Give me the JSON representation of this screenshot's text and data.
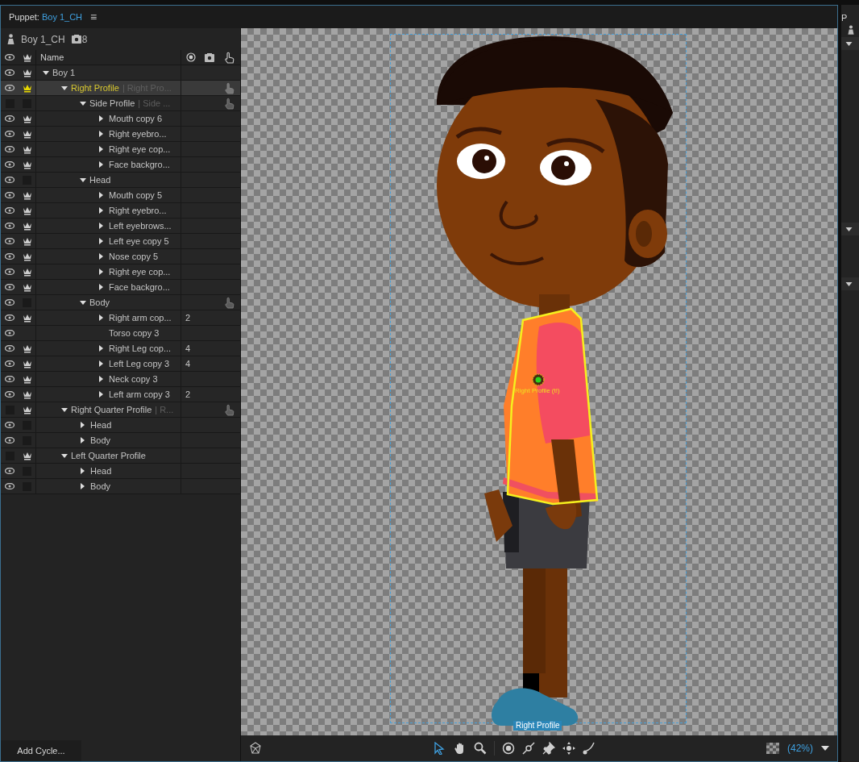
{
  "panel": {
    "title_label": "Puppet:",
    "title_name": "Boy 1_CH",
    "menu_glyph": "≡"
  },
  "puppet": {
    "name": "Boy 1_CH",
    "handle_count": "8"
  },
  "columns": {
    "name": "Name"
  },
  "layers": [
    {
      "name": "Boy 1",
      "visible": true,
      "crown": true,
      "expanded": true,
      "selected": false,
      "children": [
        {
          "name": "Right Profile",
          "note": "| Right Pro...",
          "visible": true,
          "crown": true,
          "expanded": true,
          "handle": true,
          "selected": true,
          "children": [
            {
              "name": "Side Profile",
              "note": "| Side ...",
              "visible": false,
              "crown": false,
              "expanded": true,
              "handle": true,
              "selected": false,
              "children": [
                {
                  "name": "Mouth copy 6",
                  "visible": true,
                  "crown": true,
                  "expanded": false,
                  "selected": false
                },
                {
                  "name": "Right eyebro...",
                  "visible": true,
                  "crown": true,
                  "expanded": false,
                  "selected": false
                },
                {
                  "name": "Right eye cop...",
                  "visible": true,
                  "crown": true,
                  "expanded": false,
                  "selected": false
                },
                {
                  "name": "Face backgro...",
                  "visible": true,
                  "crown": true,
                  "expanded": false,
                  "selected": false
                }
              ]
            },
            {
              "name": "Head",
              "visible": true,
              "crown": false,
              "expanded": true,
              "selected": false,
              "children": [
                {
                  "name": "Mouth copy 5",
                  "visible": true,
                  "crown": true,
                  "expanded": false,
                  "selected": false
                },
                {
                  "name": "Right eyebro...",
                  "visible": true,
                  "crown": true,
                  "expanded": false,
                  "selected": false
                },
                {
                  "name": "Left eyebrows...",
                  "visible": true,
                  "crown": true,
                  "expanded": false,
                  "selected": false
                },
                {
                  "name": "Left eye copy 5",
                  "visible": true,
                  "crown": true,
                  "expanded": false,
                  "selected": false
                },
                {
                  "name": "Nose copy 5",
                  "visible": true,
                  "crown": true,
                  "expanded": false,
                  "selected": false
                },
                {
                  "name": "Right eye cop...",
                  "visible": true,
                  "crown": true,
                  "expanded": false,
                  "selected": false
                },
                {
                  "name": "Face backgro...",
                  "visible": true,
                  "crown": true,
                  "expanded": false,
                  "selected": false
                }
              ]
            },
            {
              "name": "Body",
              "visible": true,
              "crown": false,
              "expanded": true,
              "handle": true,
              "selected": false,
              "children": [
                {
                  "name": "Right arm cop...",
                  "visible": true,
                  "crown": true,
                  "expanded": false,
                  "count": "2",
                  "selected": false
                },
                {
                  "name": "Torso copy 3",
                  "visible": true,
                  "selected": false
                },
                {
                  "name": "Right Leg cop...",
                  "visible": true,
                  "crown": true,
                  "expanded": false,
                  "count": "4",
                  "selected": false
                },
                {
                  "name": "Left Leg copy 3",
                  "visible": true,
                  "crown": true,
                  "expanded": false,
                  "count": "4",
                  "selected": false
                },
                {
                  "name": "Neck copy 3",
                  "visible": true,
                  "crown": true,
                  "expanded": false,
                  "selected": false
                },
                {
                  "name": "Left arm copy 3",
                  "visible": true,
                  "crown": true,
                  "expanded": false,
                  "count": "2",
                  "selected": false
                }
              ]
            }
          ]
        },
        {
          "name": "Right Quarter Profile",
          "note": "| R...",
          "visible": false,
          "crown": true,
          "expanded": true,
          "handle": true,
          "selected": false,
          "children": [
            {
              "name": "Head",
              "visible": true,
              "crown": false,
              "expanded": false,
              "selected": false
            },
            {
              "name": "Body",
              "visible": true,
              "crown": false,
              "expanded": false,
              "selected": false
            }
          ]
        },
        {
          "name": "Left Quarter Profile",
          "visible": false,
          "crown": true,
          "expanded": true,
          "selected": false,
          "children": [
            {
              "name": "Head",
              "visible": true,
              "crown": false,
              "expanded": false,
              "selected": false
            },
            {
              "name": "Body",
              "visible": true,
              "crown": false,
              "expanded": false,
              "selected": false
            }
          ]
        }
      ]
    }
  ],
  "add_cycle_button": "Add Cycle...",
  "canvas": {
    "handle_label": "Right Profile (t!)",
    "bounds_label": "Right Profile"
  },
  "toolbar": {
    "tools": [
      {
        "kind": "select",
        "selected": true
      },
      {
        "kind": "hand",
        "selected": false
      },
      {
        "kind": "zoom",
        "selected": false
      },
      {
        "kind": "origin",
        "selected": false
      },
      {
        "kind": "dragger",
        "selected": false
      },
      {
        "kind": "pin",
        "selected": false
      },
      {
        "kind": "fixed",
        "selected": false
      },
      {
        "kind": "stick",
        "selected": false
      }
    ],
    "zoom": "(42%)"
  },
  "side_panel": {
    "title": "P",
    "section_count_toggles": [
      {
        "expanded": true
      },
      {
        "expanded": true
      },
      {
        "expanded": true
      }
    ]
  }
}
